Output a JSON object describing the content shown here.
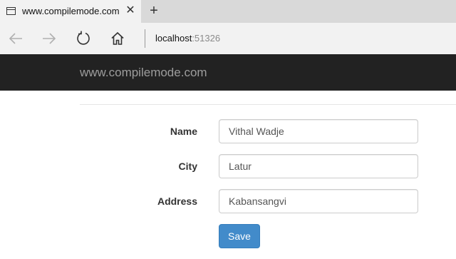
{
  "browser": {
    "tab": {
      "title": "www.compilemode.com",
      "close_glyph": "✕"
    },
    "new_tab_glyph": "+",
    "address": {
      "host": "localhost",
      "port": ":51326"
    }
  },
  "site": {
    "brand": "www.compilemode.com"
  },
  "form": {
    "fields": [
      {
        "label": "Name",
        "value": "Vithal Wadje"
      },
      {
        "label": "City",
        "value": "Latur"
      },
      {
        "label": "Address",
        "value": "Kabansangvi"
      }
    ],
    "save_label": "Save"
  },
  "colors": {
    "header_bg": "#222222",
    "brand_text": "#9d9d9d",
    "primary": "#428bca"
  }
}
